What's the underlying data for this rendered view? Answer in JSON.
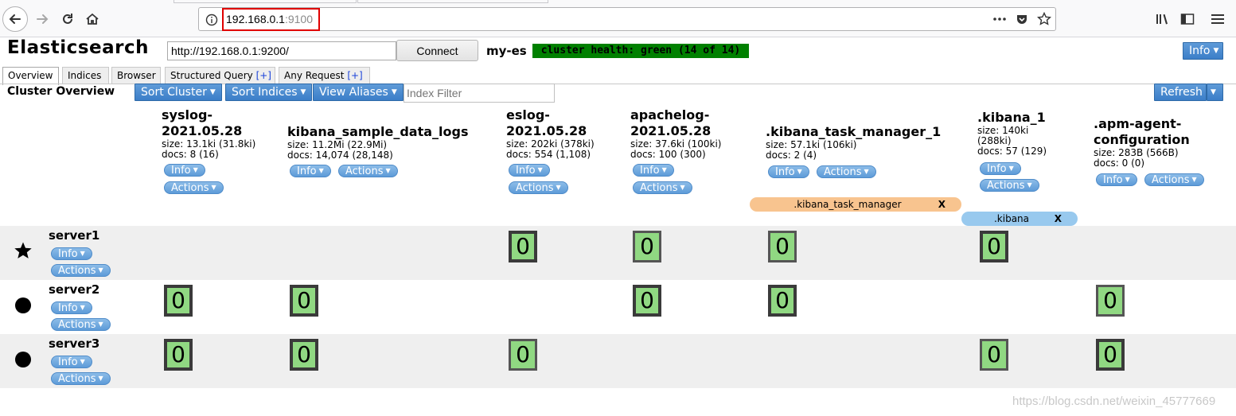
{
  "browser": {
    "url_host": "192.168.0.1",
    "url_port": ":9100"
  },
  "app": {
    "title": "Elasticsearch",
    "connect_url": "http://192.168.0.1:9200/",
    "connect_label": "Connect",
    "cluster_name": "my-es",
    "health": "cluster health: green (14 of 14)",
    "info_label": "Info"
  },
  "tabs": [
    {
      "label": "Overview"
    },
    {
      "label": "Indices"
    },
    {
      "label": "Browser"
    },
    {
      "label": "Structured Query",
      "plus": "[+]"
    },
    {
      "label": "Any Request",
      "plus": "[+]"
    }
  ],
  "toolbar": {
    "section_title": "Cluster Overview",
    "sort_cluster": "Sort Cluster",
    "sort_indices": "Sort Indices",
    "view_aliases": "View Aliases",
    "index_filter_placeholder": "Index Filter",
    "refresh": "Refresh"
  },
  "indices": [
    {
      "name_lines": [
        "syslog-",
        "2021.05.28"
      ],
      "size": "size: 13.1ki (31.8ki)",
      "docs": "docs: 8 (16)"
    },
    {
      "name_lines": [
        "kibana_sample_data_logs"
      ],
      "size": "size: 11.2Mi (22.9Mi)",
      "docs": "docs: 14,074 (28,148)"
    },
    {
      "name_lines": [
        "eslog-",
        "2021.05.28"
      ],
      "size": "size: 202ki (378ki)",
      "docs": "docs: 554 (1,108)"
    },
    {
      "name_lines": [
        "apachelog-",
        "2021.05.28"
      ],
      "size": "size: 37.6ki (100ki)",
      "docs": "docs: 100 (300)"
    },
    {
      "name_lines": [
        ".kibana_task_manager_1"
      ],
      "size": "size: 57.1ki (106ki)",
      "docs": "docs: 2 (4)"
    },
    {
      "name_lines": [
        ".kibana_1"
      ],
      "size": "size: 140ki",
      "size2": "(288ki)",
      "docs": "docs: 57 (129)"
    },
    {
      "name_lines": [
        ".apm-agent-",
        "configuration"
      ],
      "size": "size: 283B (566B)",
      "docs": "docs: 0 (0)"
    }
  ],
  "button_labels": {
    "info": "Info",
    "actions": "Actions",
    "close": "X"
  },
  "aliases": [
    {
      "label": ".kibana_task_manager",
      "color": "#f8c48f"
    },
    {
      "label": ".kibana",
      "color": "#98c9ee"
    }
  ],
  "servers": [
    {
      "name": "server1",
      "marker": "star",
      "shard_value": "0"
    },
    {
      "name": "server2",
      "marker": "circle",
      "shard_value": "0"
    },
    {
      "name": "server3",
      "marker": "circle",
      "shard_value": "0"
    }
  ],
  "watermark": "https://blog.csdn.net/weixin_45777669"
}
